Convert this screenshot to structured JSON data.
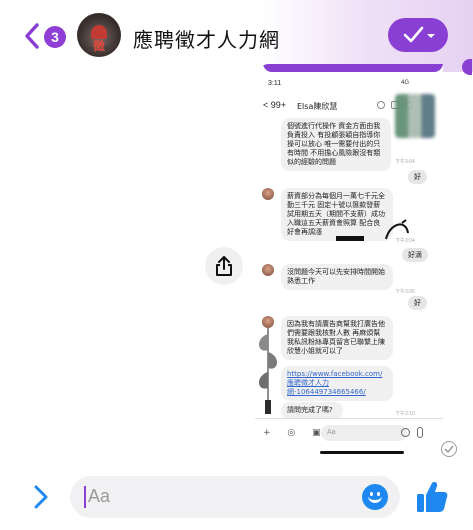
{
  "header": {
    "back_label": "<",
    "unread_count": "3",
    "avatar_text": "徵",
    "title": "應聘徵才人力網",
    "accent": "#8a3fd4"
  },
  "screenshot": {
    "status_time": "3:11",
    "status_right": "4G",
    "nav_back": "< 99+",
    "nav_name": "Elsa陳欣慧",
    "messages": [
      {
        "text": "個號進行代操作 資金方面由我負責投入 有投顧張穎自指導你操可以放心 唯一需要付出的只有時間 不用擔心風險跟沒有類似的經驗的問題",
        "time": "下午3:04"
      },
      {
        "text": "薪資部分為每個月一萬七千元全勤三千元 固定十號以匯款發薪 試用期五天（期間不支薪）成功入職這五天薪資會照算 配合良好會再調漲",
        "time": "下午3:04"
      },
      {
        "text": "沒問題今天可以先安排時間開始熟悉工作",
        "time": "下午3:05"
      },
      {
        "text": "因為我有請廣告商幫我打廣告他們需要跟我核對人數 再麻煩幫我私訊粉絲專頁留言已聯繫上陳欣慧小姐就可以了",
        "link": "https://www.facebook.com/應聘徵才人力網-106449734665466/",
        "time": ""
      },
      {
        "text": "請問完成了嗎?",
        "time": "下午3:10"
      }
    ],
    "replies": [
      "好",
      "好滴",
      "好"
    ],
    "composer_placeholder": "Aa"
  },
  "bottom": {
    "placeholder": "Aa"
  },
  "icons": [
    "back-icon",
    "share-icon",
    "emoji-icon",
    "thumbs-up-icon",
    "expand-chevron-icon",
    "check-icon",
    "seen-check-icon"
  ]
}
